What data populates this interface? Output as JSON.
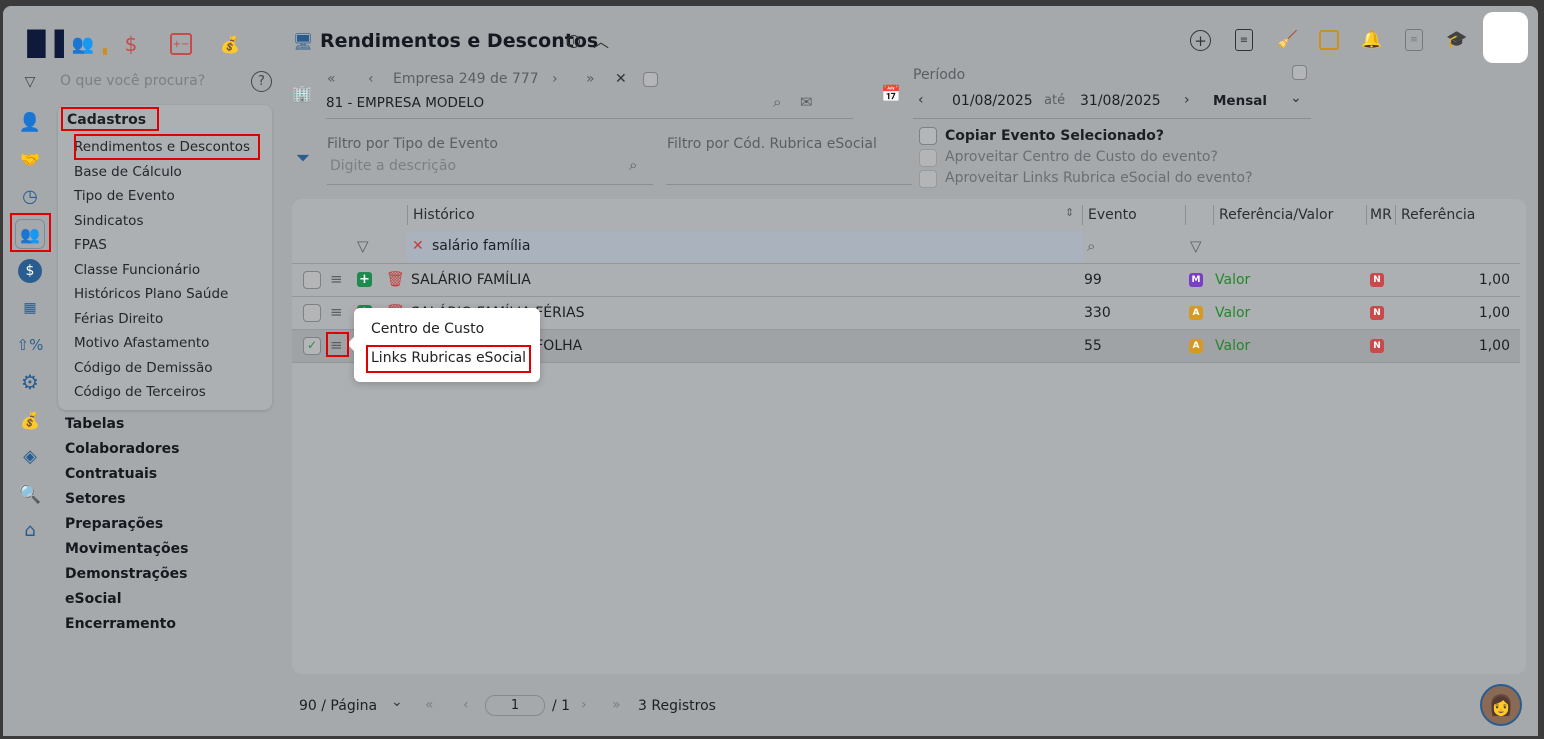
{
  "header": {
    "title": "Rendimentos e Descontos"
  },
  "search": {
    "placeholder": "O que você procura?"
  },
  "menu": {
    "group": "Cadastros",
    "items": [
      "Rendimentos e Descontos",
      "Base de Cálculo",
      "Tipo de Evento",
      "Sindicatos",
      "FPAS",
      "Classe Funcionário",
      "Históricos Plano Saúde",
      "Férias Direito",
      "Motivo Afastamento",
      "Código de Demissão",
      "Código de Terceiros"
    ],
    "groups": [
      "Tabelas",
      "Colaboradores",
      "Contratuais",
      "Setores",
      "Preparações",
      "Movimentações",
      "Demonstrações",
      "eSocial",
      "Encerramento"
    ]
  },
  "empresa": {
    "nav_label": "Empresa",
    "current": "249",
    "de": "de",
    "total": "777",
    "name": "81 - EMPRESA MODELO"
  },
  "periodo": {
    "label": "Período",
    "start": "01/08/2025",
    "ate": "até",
    "end": "31/08/2025",
    "type": "Mensal"
  },
  "filters": {
    "tipo_label": "Filtro por Tipo de Evento",
    "tipo_placeholder": "Digite a descrição",
    "rubrica_label": "Filtro por Cód. Rubrica eSocial"
  },
  "options": {
    "copiar": "Copiar Evento Selecionado?",
    "centro": "Aproveitar Centro de Custo do evento?",
    "links": "Aproveitar Links Rubrica eSocial do evento?"
  },
  "table": {
    "columns": {
      "historico": "Histórico",
      "evento": "Evento",
      "refval": "Referência/Valor",
      "mr": "MR",
      "referencia": "Referência"
    },
    "filter_value": "salário família",
    "rows": [
      {
        "historico": "SALÁRIO FAMÍLIA",
        "evento": "99",
        "tipo": "M",
        "tipo_color": "#7b3fc4",
        "refval": "Valor",
        "mr": "N",
        "referencia": "1,00",
        "checked": false
      },
      {
        "historico": "SALÁRIO FAMÍLIA FÉRIAS",
        "evento": "330",
        "tipo": "A",
        "tipo_color": "#d49a22",
        "refval": "Valor",
        "mr": "N",
        "referencia": "1,00",
        "checked": false
      },
      {
        "historico": "SALÁRIO FAMÍLIA FOLHA",
        "evento": "55",
        "tipo": "A",
        "tipo_color": "#d49a22",
        "refval": "Valor",
        "mr": "N",
        "referencia": "1,00",
        "checked": true
      }
    ]
  },
  "popup": {
    "items": [
      "Centro de Custo",
      "Links Rubricas eSocial"
    ]
  },
  "pagination": {
    "per_page": "90 / Página",
    "page": "1",
    "total_pages": "/ 1",
    "records": "3 Registros"
  }
}
